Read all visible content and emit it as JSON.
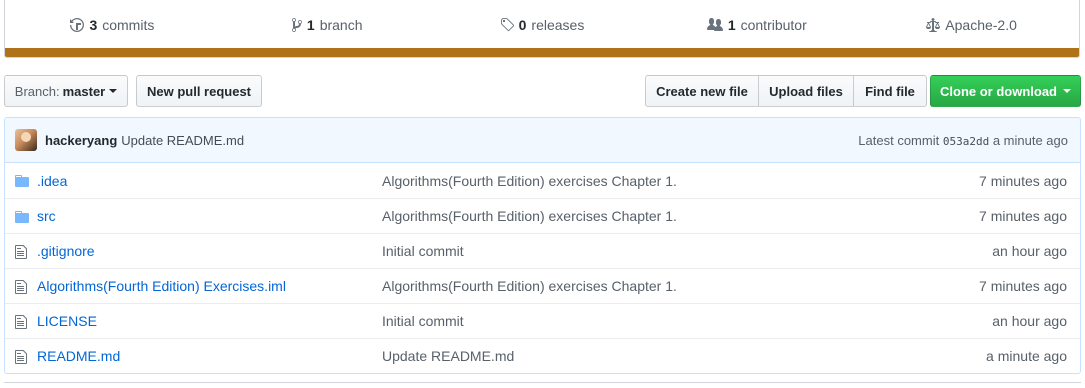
{
  "summary": {
    "commits": {
      "count": "3",
      "label": "commits",
      "icon": "history-icon"
    },
    "branches": {
      "count": "1",
      "label": "branch",
      "icon": "git-branch-icon"
    },
    "releases": {
      "count": "0",
      "label": "releases",
      "icon": "tag-icon"
    },
    "contributors": {
      "count": "1",
      "label": "contributor",
      "icon": "people-icon"
    },
    "license": {
      "label": "Apache-2.0",
      "icon": "law-icon"
    },
    "language_color": "#b07219"
  },
  "toolbar": {
    "branch_prefix": "Branch:",
    "branch_name": "master",
    "new_pr_label": "New pull request",
    "create_file_label": "Create new file",
    "upload_files_label": "Upload files",
    "find_file_label": "Find file",
    "clone_label": "Clone or download",
    "clone_color": "#28a745"
  },
  "latest_commit": {
    "author": "hackeryang",
    "message": "Update README.md",
    "prefix": "Latest commit",
    "sha": "053a2dd",
    "age": "a minute ago"
  },
  "files": [
    {
      "type": "directory",
      "icon": "folder-icon",
      "name": ".idea",
      "commit": "Algorithms(Fourth Edition) exercises Chapter 1.",
      "age": "7 minutes ago"
    },
    {
      "type": "directory",
      "icon": "folder-icon",
      "name": "src",
      "commit": "Algorithms(Fourth Edition) exercises Chapter 1.",
      "age": "7 minutes ago"
    },
    {
      "type": "file",
      "icon": "file-icon",
      "name": ".gitignore",
      "commit": "Initial commit",
      "age": "an hour ago"
    },
    {
      "type": "file",
      "icon": "file-icon",
      "name": "Algorithms(Fourth Edition) Exercises.iml",
      "commit": "Algorithms(Fourth Edition) exercises Chapter 1.",
      "age": "7 minutes ago"
    },
    {
      "type": "file",
      "icon": "file-icon",
      "name": "LICENSE",
      "commit": "Initial commit",
      "age": "an hour ago"
    },
    {
      "type": "file",
      "icon": "file-icon",
      "name": "README.md",
      "commit": "Update README.md",
      "age": "a minute ago"
    }
  ]
}
